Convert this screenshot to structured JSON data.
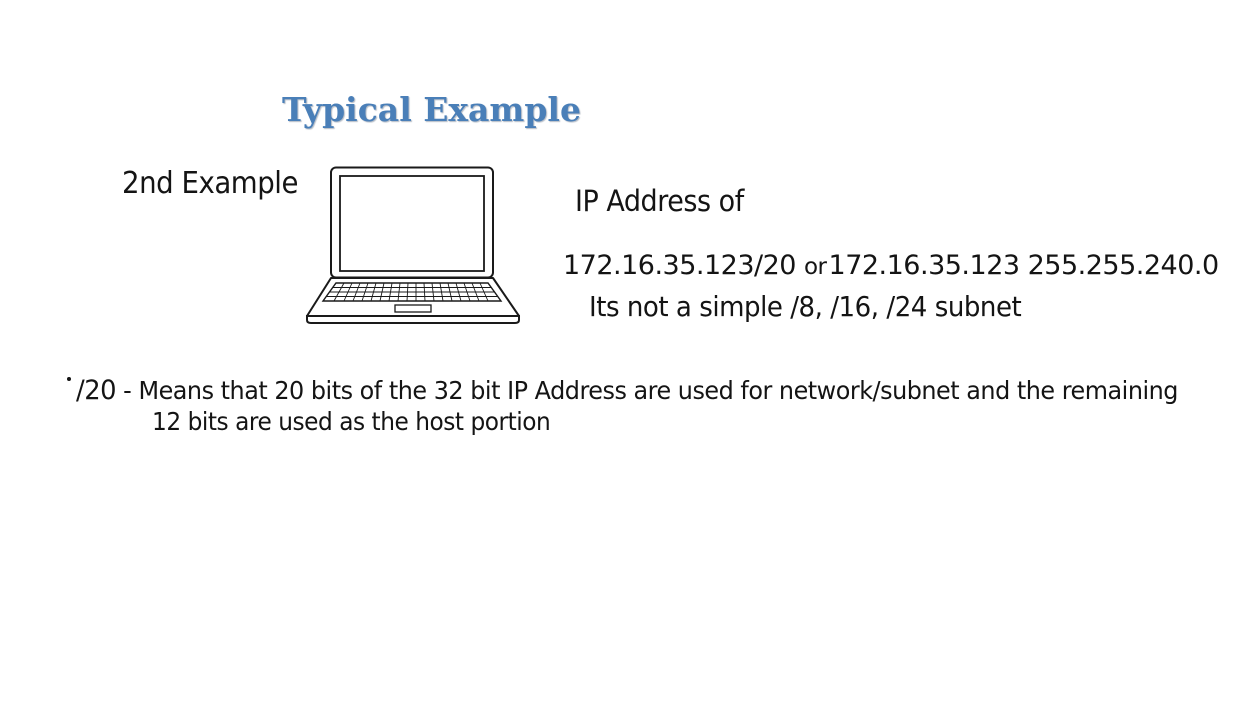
{
  "slide": {
    "title": "Typical Example",
    "example_label": "2nd Example",
    "ip_heading": "IP Address of",
    "ip_cidr": "172.16.35.123/20",
    "ip_or": "or",
    "ip_mask_form": "172.16.35.123 255.255.240.0",
    "note": "Its not a simple /8, /16, /24 subnet",
    "bullet": {
      "prefix": "/20",
      "dash": "-",
      "line1": "Means that 20 bits of the 32 bit IP Address are used for network/subnet and the remaining",
      "line2": "12 bits are used as the host portion"
    },
    "illustration_icon": "laptop-icon"
  }
}
